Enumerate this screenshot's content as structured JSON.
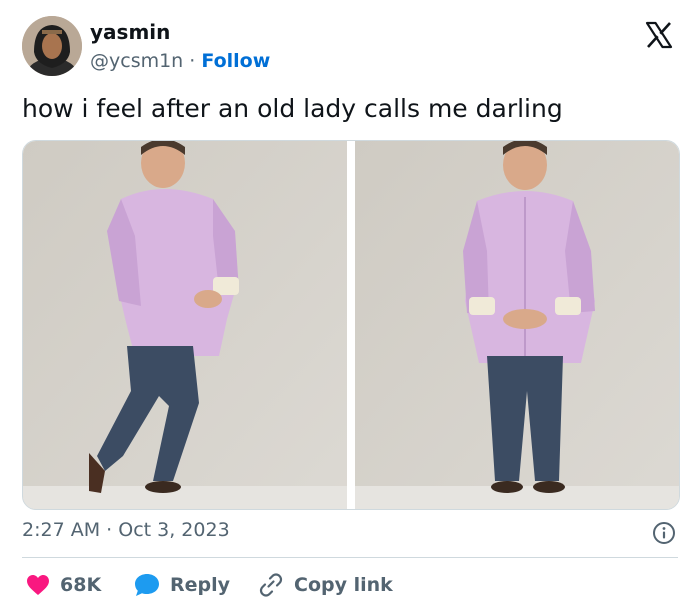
{
  "tweet": {
    "author_name": "yasmin",
    "handle": "@ycsm1n",
    "separator": "·",
    "follow_label": "Follow",
    "text": "how i feel after an old lady calls me darling",
    "time": "2:27 AM",
    "date": "Oct 3, 2023",
    "date_separator": "·"
  },
  "actions": {
    "likes": "68K",
    "reply_label": "Reply",
    "copy_link_label": "Copy link"
  },
  "colors": {
    "like": "#f91880",
    "reply": "#1d9bf0",
    "link": "#006fd6",
    "muted": "#536471"
  },
  "icons": {
    "brand": "x-logo-icon",
    "like": "heart-icon",
    "reply": "speech-bubble-icon",
    "copy": "link-icon",
    "info": "info-icon"
  }
}
